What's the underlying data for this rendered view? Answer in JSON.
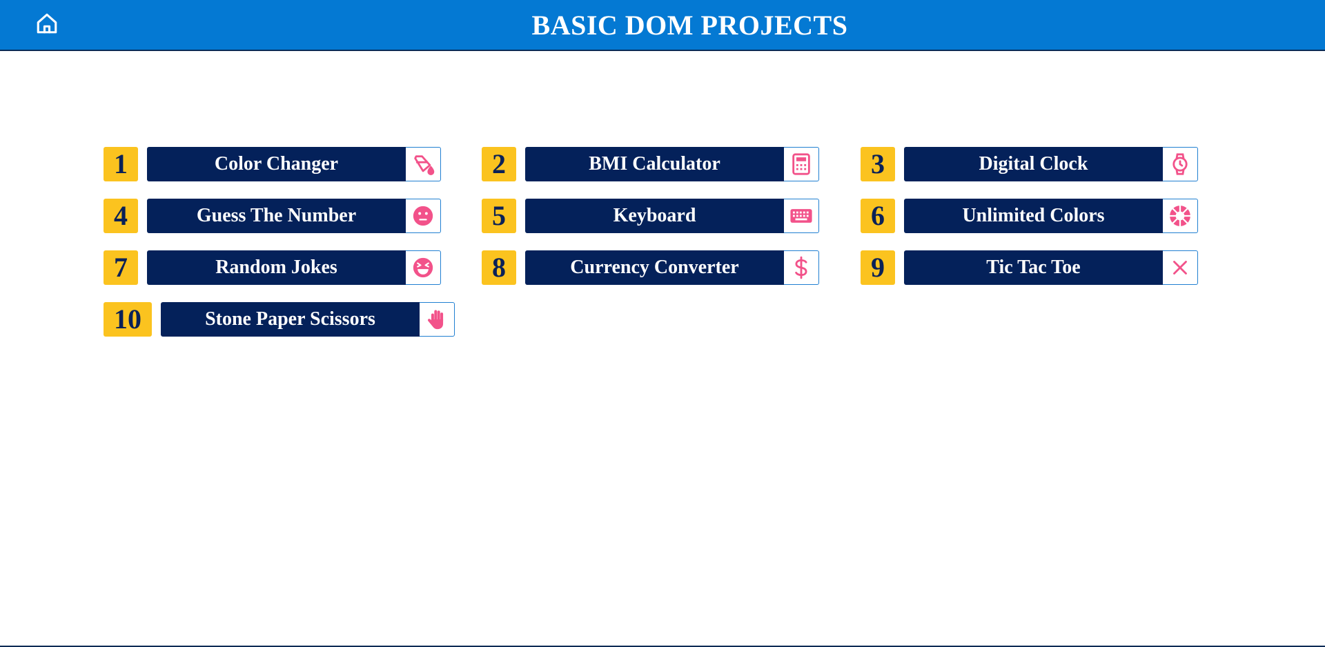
{
  "header": {
    "title": "BASIC DOM PROJECTS",
    "home_icon": "home-icon",
    "background": "#0479d3"
  },
  "colors": {
    "number_badge": "#fbc31f",
    "name_bar": "#04215a",
    "icon_accent": "#f2528a"
  },
  "projects": [
    {
      "number": "1",
      "name": "Color Changer",
      "icon": "paint-bucket-icon"
    },
    {
      "number": "2",
      "name": "BMI Calculator",
      "icon": "calculator-icon"
    },
    {
      "number": "3",
      "name": "Digital Clock",
      "icon": "watch-icon"
    },
    {
      "number": "4",
      "name": "Guess The Number",
      "icon": "neutral-face-icon"
    },
    {
      "number": "5",
      "name": "Keyboard",
      "icon": "keyboard-icon"
    },
    {
      "number": "6",
      "name": "Unlimited Colors",
      "icon": "color-wheel-icon"
    },
    {
      "number": "7",
      "name": "Random Jokes",
      "icon": "laughing-face-icon"
    },
    {
      "number": "8",
      "name": "Currency Converter",
      "icon": "dollar-icon"
    },
    {
      "number": "9",
      "name": "Tic Tac Toe",
      "icon": "x-mark-icon"
    },
    {
      "number": "10",
      "name": "Stone Paper Scissors",
      "icon": "hand-icon"
    }
  ]
}
